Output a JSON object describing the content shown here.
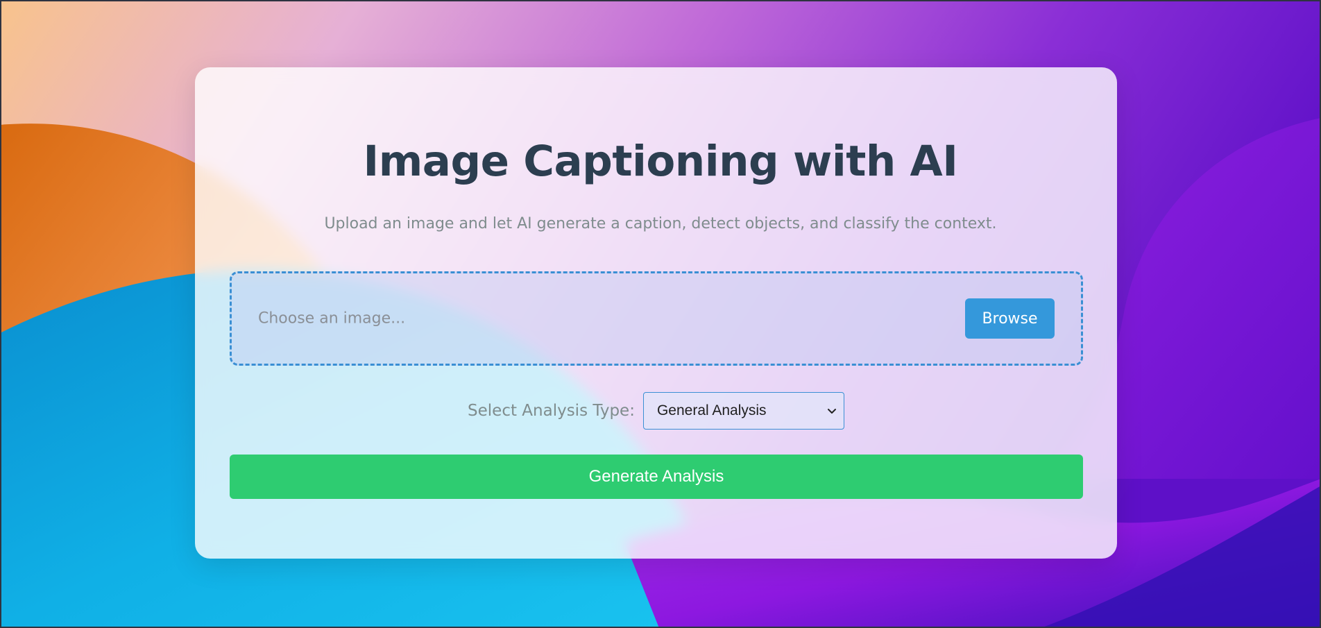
{
  "page": {
    "title": "Image Captioning with AI",
    "subtitle": "Upload an image and let AI generate a caption, detect objects, and classify the context."
  },
  "upload": {
    "placeholder": "Choose an image...",
    "browse_label": "Browse"
  },
  "analysis": {
    "label": "Select Analysis Type:",
    "selected": "General Analysis"
  },
  "actions": {
    "generate_label": "Generate Analysis"
  },
  "icons": {
    "select_arrow": "chevron-down-icon"
  },
  "colors": {
    "title": "#2c3e50",
    "subtitle": "#7f8c8d",
    "browse_button": "#3498db",
    "generate_button": "#2ecc71",
    "upload_border": "#3a8fd4"
  }
}
